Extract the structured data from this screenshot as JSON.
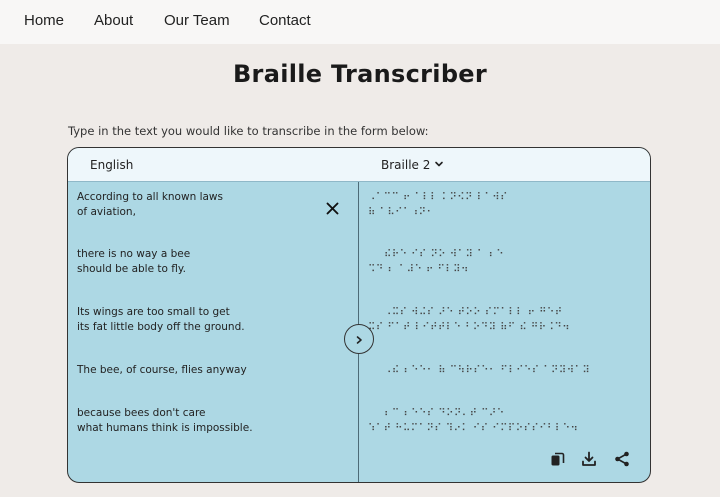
{
  "nav": {
    "items": [
      "Home",
      "About",
      "Our Team",
      "Contact"
    ]
  },
  "page": {
    "title": "Braille Transcriber",
    "intro": "Type in the text you would like to transcribe in the form below:"
  },
  "transcriber": {
    "source_language": "English",
    "target_language": "Braille 2",
    "source_lines": [
      "According to all known laws",
      "of aviation,",
      "there is no way a bee",
      "should be able to fly.",
      "Its wings are too small to get",
      "its fat little body off the ground.",
      "The bee, of course, flies anyway",
      "because bees don't care",
      "what humans think is impossible."
    ],
    "braille_lines": [
      "⠠⠁⠉⠉ ⠖ ⠁⠇⠇ ⠅⠝⠪⠝ ⠇⠁⠺⠎",
      "⠷ ⠁⠧⠊⠁⠰⠝⠂",
      "⠮⠗⠑ ⠊⠎ ⠝⠕ ⠺⠁⠽ ⠁ ⠆⠑",
      "⠩⠙ ⠆ ⠁⠼⠑ ⠖ ⠋⠇⠽⠲",
      "⠠⠭⠎ ⠺⠬⠎ ⠜⠑ ⠞⠕⠕ ⠎⠍⠁⠇⠇ ⠖ ⠛⠑⠞",
      "⠭⠎ ⠋⠁⠞ ⠇⠊⠞⠞⠇⠑ ⠃⠕⠙⠽ ⠷⠋ ⠮ ⠛⠗⠨⠙⠲",
      "⠠⠮ ⠆⠑⠑⠂ ⠷ ⠉⠳⠗⠎⠑⠂ ⠋⠇⠊⠑⠎ ⠁⠝⠽⠺⠁⠽",
      "⠆⠉ ⠆⠑⠑⠎ ⠙⠕⠝⠄⠞ ⠉⠜⠑",
      "⠱⠁⠞ ⠓⠥⠍⠁⠝⠎ ⠹⠔⠅ ⠊⠎ ⠊⠍⠏⠕⠎⠎⠊⠃⠇⠑⠲"
    ]
  },
  "icons": {
    "clear": "close-icon",
    "transcribe": "chevron-right-icon",
    "copy": "copy-icon",
    "download": "download-icon",
    "share": "share-icon"
  },
  "colors": {
    "panel": "#add8e4",
    "header": "#eef7fb",
    "background": "#efebe8"
  }
}
